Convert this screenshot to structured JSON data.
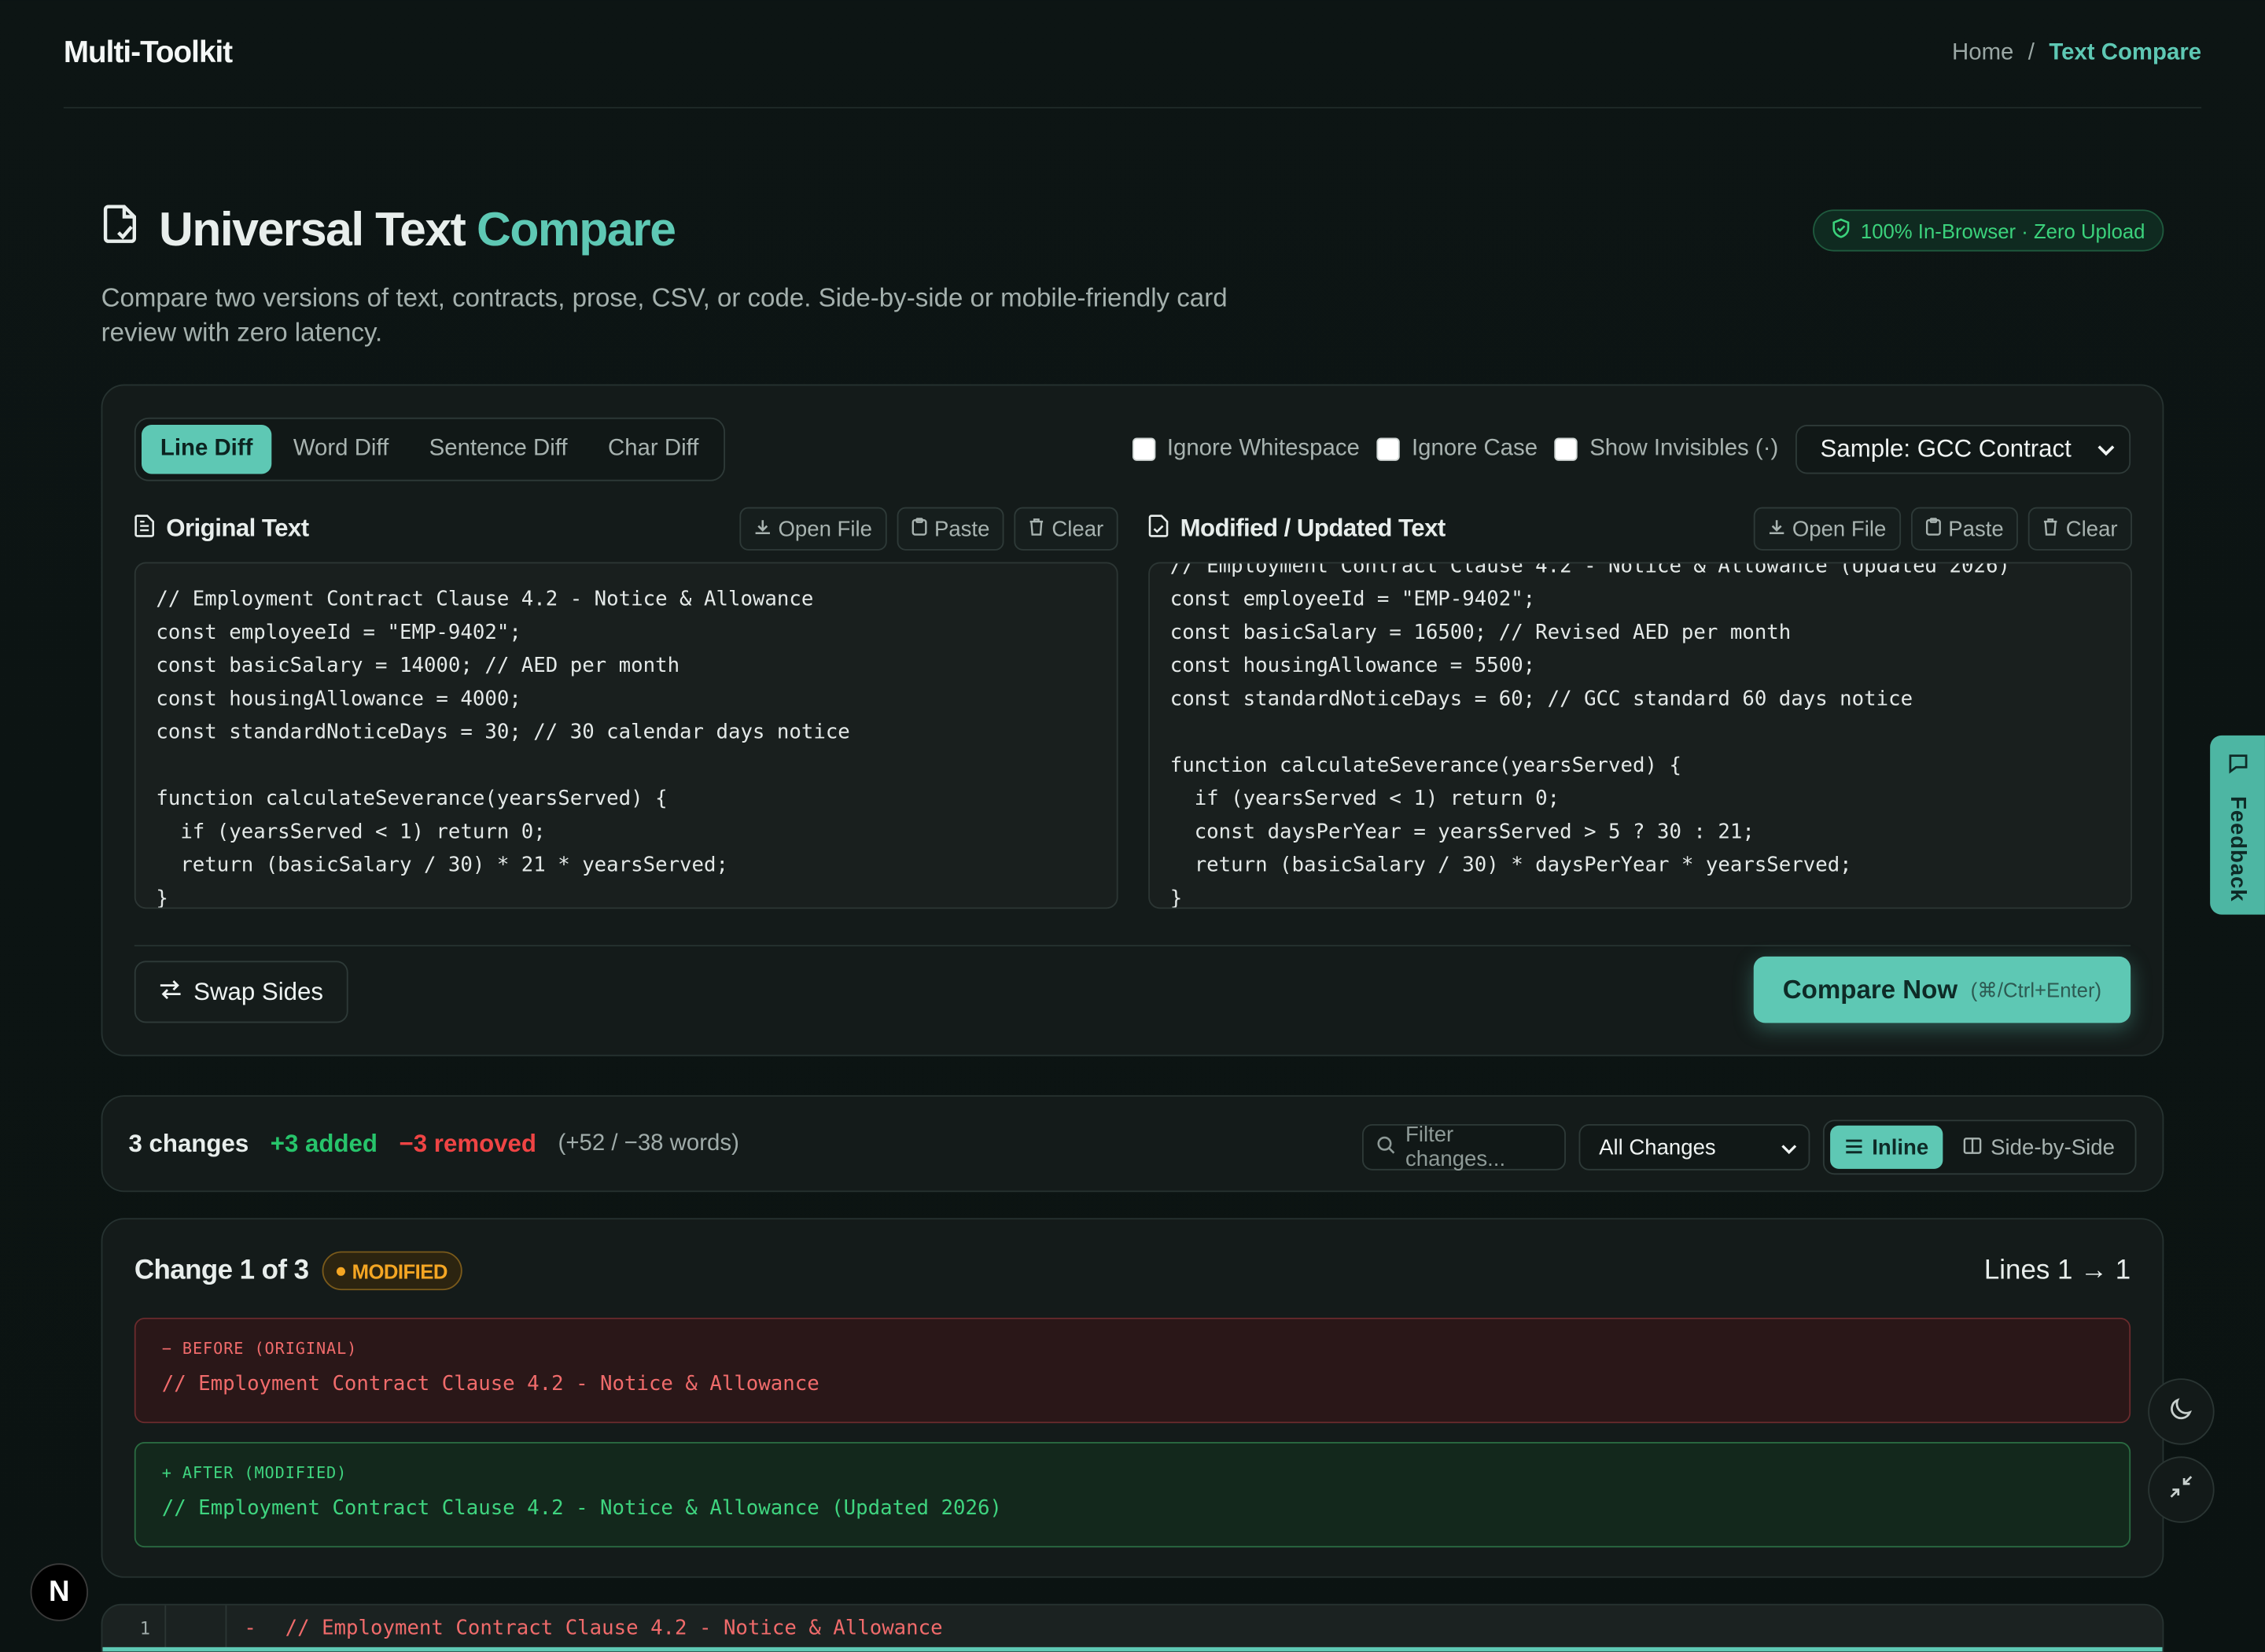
{
  "header": {
    "brand": "Multi-Toolkit",
    "breadcrumb": [
      "Home",
      "/",
      "Text Compare"
    ]
  },
  "hero": {
    "title_part1": "Universal Text",
    "title_part2": "Compare",
    "description": "Compare two versions of text, contracts, prose, CSV, or code. Side-by-side or mobile-friendly card review with zero latency.",
    "privacy_badge": "100% In-Browser · Zero Upload"
  },
  "modes": {
    "tabs": [
      "Line Diff",
      "Word Diff",
      "Sentence Diff",
      "Char Diff"
    ],
    "active": "Line Diff"
  },
  "options": {
    "ignore_whitespace": "Ignore Whitespace",
    "ignore_case": "Ignore Case",
    "show_invisibles": "Show Invisibles (·)",
    "sample_selected": "Sample: GCC Contract"
  },
  "original": {
    "title": "Original Text",
    "open_file": "Open File",
    "paste": "Paste",
    "clear": "Clear",
    "text": "// Employment Contract Clause 4.2 - Notice & Allowance\nconst employeeId = \"EMP-9402\";\nconst basicSalary = 14000; // AED per month\nconst housingAllowance = 4000;\nconst standardNoticeDays = 30; // 30 calendar days notice\n\nfunction calculateSeverance(yearsServed) {\n  if (yearsServed < 1) return 0;\n  return (basicSalary / 30) * 21 * yearsServed;\n}"
  },
  "modified": {
    "title": "Modified / Updated Text",
    "open_file": "Open File",
    "paste": "Paste",
    "clear": "Clear",
    "text": "// Employment Contract Clause 4.2 - Notice & Allowance (Updated 2026)\nconst employeeId = \"EMP-9402\";\nconst basicSalary = 16500; // Revised AED per month\nconst housingAllowance = 5500;\nconst standardNoticeDays = 60; // GCC standard 60 days notice\n\nfunction calculateSeverance(yearsServed) {\n  if (yearsServed < 1) return 0;\n  const daysPerYear = yearsServed > 5 ? 30 : 21;\n  return (basicSalary / 30) * daysPerYear * yearsServed;\n}"
  },
  "actions": {
    "swap": "Swap Sides",
    "compare": "Compare Now",
    "compare_shortcut": "(⌘/Ctrl+Enter)"
  },
  "stats": {
    "changes": "3 changes",
    "added": "+3 added",
    "removed": "−3 removed",
    "words": "(+52 / −38 words)",
    "filter_placeholder": "Filter changes...",
    "filter_select": "All Changes",
    "view_inline": "Inline",
    "view_side": "Side-by-Side"
  },
  "change_card": {
    "title": "Change 1 of 3",
    "badge": "MODIFIED",
    "lines": "Lines 1 → 1",
    "before_label": "− BEFORE (ORIGINAL)",
    "before_text": "// Employment Contract Clause 4.2 - Notice & Allowance",
    "after_label": "+ AFTER (MODIFIED)",
    "after_text": "// Employment Contract Clause 4.2 - Notice & Allowance (Updated 2026)"
  },
  "inline_diff": {
    "line_no": "1",
    "marker": "-",
    "text": "// Employment Contract Clause 4.2 - Notice & Allowance"
  },
  "feedback": {
    "label": "Feedback"
  },
  "colors": {
    "accent": "#5ec8b4",
    "added": "#27c46b",
    "removed": "#ef4444",
    "modified": "#f5a623"
  }
}
